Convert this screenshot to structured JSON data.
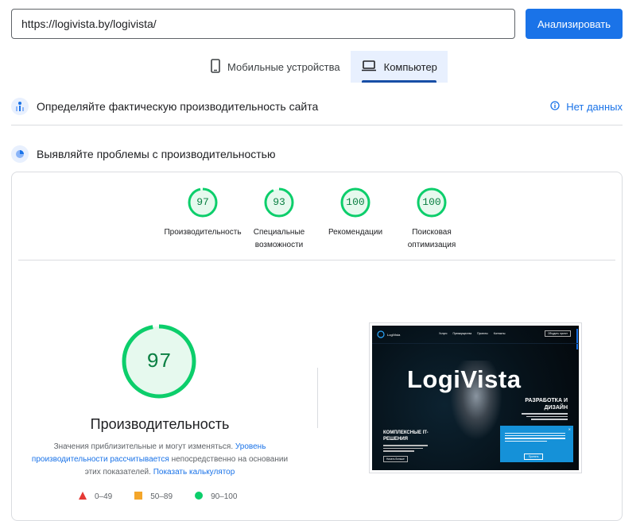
{
  "url_input": {
    "value": "https://logivista.by/logivista/"
  },
  "analyze_label": "Анализировать",
  "tabs": [
    {
      "label": "Мобильные устройства",
      "icon": "phone-icon",
      "active": false
    },
    {
      "label": "Компьютер",
      "icon": "laptop-icon",
      "active": true
    }
  ],
  "field_data": {
    "title": "Определяйте фактическую производительность сайта",
    "status": "Нет данных"
  },
  "lab_data": {
    "title": "Выявляйте проблемы с производительностью"
  },
  "scores": [
    {
      "value": "97",
      "label": "Производительность"
    },
    {
      "value": "93",
      "label": "Специальные возможности"
    },
    {
      "value": "100",
      "label": "Рекомендации"
    },
    {
      "value": "100",
      "label": "Поисковая оптимизация"
    }
  ],
  "performance": {
    "score": "97",
    "title": "Производительность",
    "desc_prefix": "Значения приблизительные и могут изменяться. ",
    "desc_link1": "Уровень производительности рассчитывается",
    "desc_middle": " непосредственно на основании этих показателей. ",
    "desc_link2": "Показать калькулятор"
  },
  "legend": [
    {
      "range": "0–49",
      "color": "#e53935",
      "shape": "triangle"
    },
    {
      "range": "50–89",
      "color": "#f4a62a",
      "shape": "square"
    },
    {
      "range": "90–100",
      "color": "#0cce6b",
      "shape": "circle"
    }
  ],
  "thumbnail": {
    "nav": [
      "Услуги",
      "Преимущества",
      "Проекты",
      "Контакты"
    ],
    "nav_button": "Обсудить проект",
    "brand": "LogiVista",
    "headline": "LogiVista",
    "side_title": "РАЗРАБОТКА И ДИЗАЙН",
    "left_title": "КОМПЛЕКСНЫЕ IT-РЕШЕНИЯ",
    "left_button": "Начать больше",
    "cookie_button": "Принять"
  },
  "colors": {
    "accent": "#1a73e8",
    "pass": "#0cce6b",
    "pass_text": "#0b8043",
    "average": "#f4a62a",
    "fail": "#e53935"
  }
}
